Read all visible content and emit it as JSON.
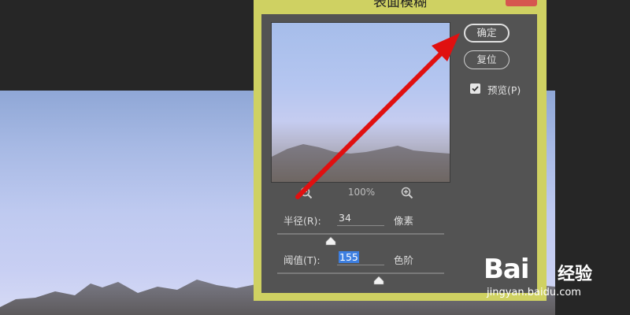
{
  "dialog": {
    "title": "表面模糊",
    "ok_label": "确定",
    "reset_label": "复位",
    "preview_label": "预览(P)",
    "preview_checked": true,
    "zoom_level": "100%",
    "radius": {
      "label": "半径(R):",
      "value": "34",
      "unit": "像素",
      "slider_fraction": 0.32
    },
    "threshold": {
      "label": "阈值(T):",
      "value": "155",
      "unit": "色阶",
      "slider_fraction": 0.61
    }
  },
  "watermark": {
    "logo": "Bai",
    "brand_cn": "经验",
    "url": "jingyan.baidu.com"
  },
  "colors": {
    "dialog_frame": "#cfd162",
    "dialog_body": "#535353",
    "close_button": "#d6564f",
    "arrow": "#e01010",
    "selection": "#3d7fe1"
  },
  "icons": {
    "zoom_out": "zoom-out-icon",
    "zoom_in": "zoom-in-icon",
    "checkbox": "checkmark-icon"
  }
}
